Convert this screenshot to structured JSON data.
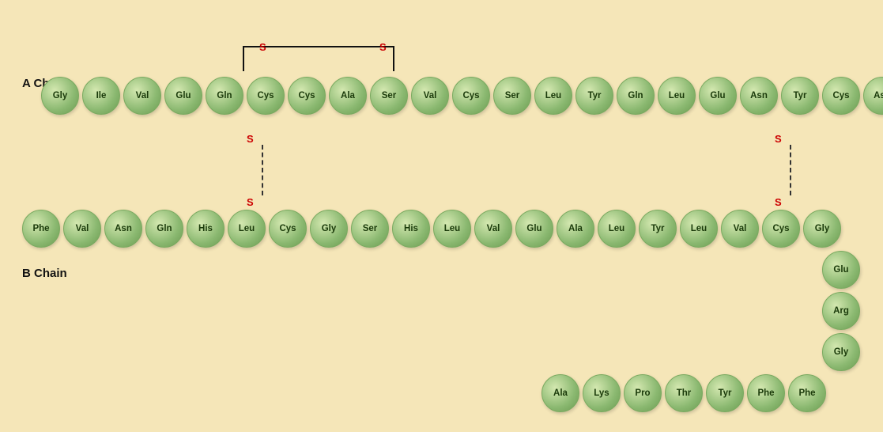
{
  "labels": {
    "a_chain": "A Chain",
    "b_chain": "B Chain"
  },
  "a_chain": [
    "Gly",
    "Ile",
    "Val",
    "Glu",
    "Gln",
    "Cys",
    "Cys",
    "Ala",
    "Ser",
    "Val",
    "Cys",
    "Ser",
    "Leu",
    "Tyr",
    "Gln",
    "Leu",
    "Glu",
    "Asn",
    "Tyr",
    "Cys",
    "Asn"
  ],
  "b_chain_row1": [
    "Phe",
    "Val",
    "Asn",
    "Gln",
    "His",
    "Leu",
    "Cys",
    "Gly",
    "Ser",
    "His",
    "Leu",
    "Val",
    "Glu",
    "Ala",
    "Leu",
    "Tyr",
    "Leu",
    "Val",
    "Cys",
    "Gly"
  ],
  "b_chain_row2": [
    "Glu",
    "Arg",
    "Gly"
  ],
  "b_chain_row3": [
    "Ala",
    "Lys",
    "Pro",
    "Thr",
    "Tyr",
    "Phe",
    "Phe"
  ]
}
